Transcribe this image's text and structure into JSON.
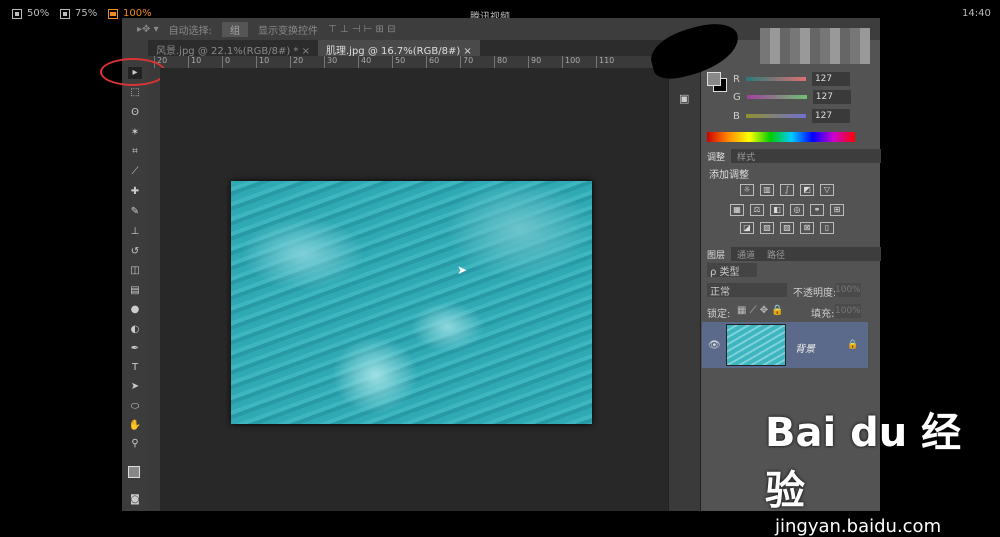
{
  "player": {
    "title": "腾讯视频",
    "time": "14:40",
    "zoom": [
      {
        "label": "50%"
      },
      {
        "label": "75%"
      },
      {
        "label": "100%",
        "active": true
      }
    ]
  },
  "options": {
    "auto_select": "自动选择:",
    "group": "组",
    "show_transform": "显示变换控件"
  },
  "tabs": [
    {
      "label": "风景.jpg @ 22.1%(RGB/8#) *"
    },
    {
      "label": "肌理.jpg @ 16.7%(RGB/8#)",
      "active": true
    }
  ],
  "ruler": [
    "20",
    "10",
    "0",
    "10",
    "20",
    "30",
    "40",
    "50",
    "60",
    "70",
    "80",
    "90",
    "100",
    "110"
  ],
  "color": {
    "r_label": "R",
    "g_label": "G",
    "b_label": "B",
    "r": "127",
    "g": "127",
    "b": "127"
  },
  "adjust": {
    "tabs": [
      "调整",
      "样式"
    ],
    "title": "添加调整"
  },
  "layers": {
    "tabs": [
      "图层",
      "通道",
      "路径"
    ],
    "filter": "ρ 类型",
    "blend": "正常",
    "opacity_label": "不透明度:",
    "opacity": "100%",
    "lock_label": "锁定:",
    "fill_label": "填充:",
    "fill": "100%",
    "layer_name": "背景"
  },
  "watermark": {
    "brand": "Bai du 经验",
    "url": "jingyan.baidu.com"
  }
}
